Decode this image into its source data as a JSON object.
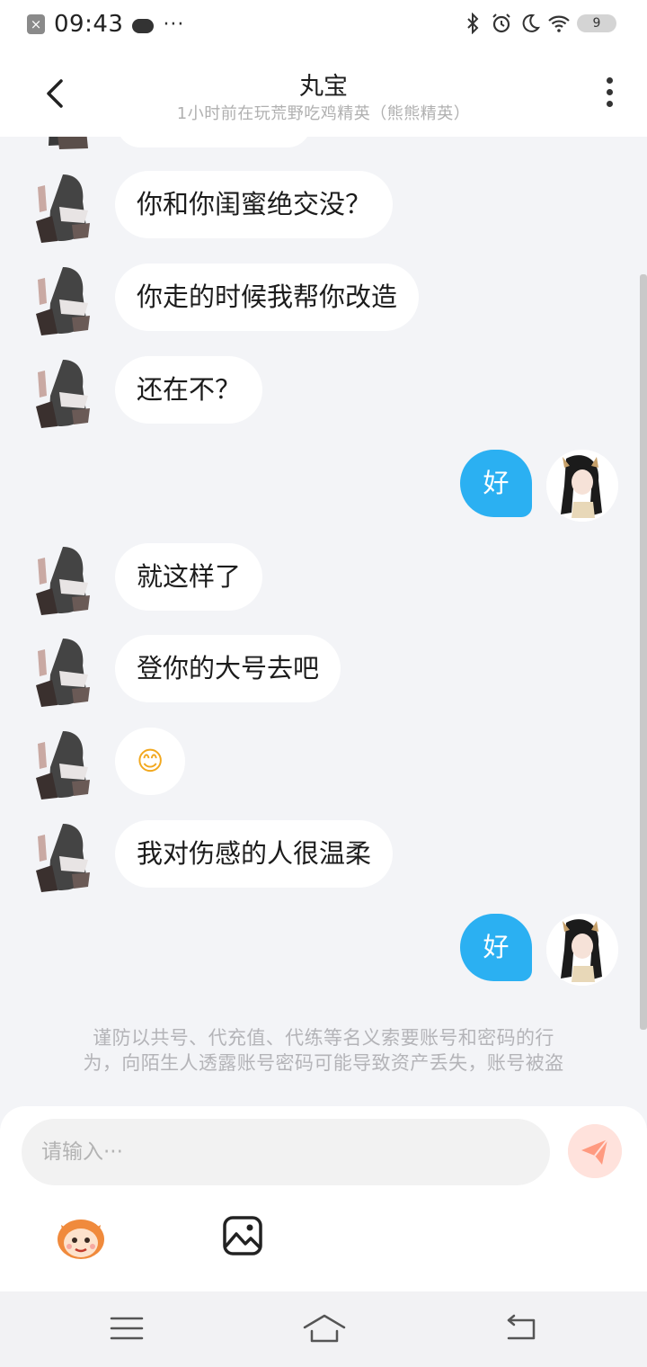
{
  "status_bar": {
    "time": "09:43",
    "notification_badge": "9",
    "more": "···",
    "icons": [
      "bluetooth-icon",
      "alarm-icon",
      "do-not-disturb-icon",
      "wifi-icon",
      "battery-icon"
    ]
  },
  "header": {
    "title": "丸宝",
    "subtitle": "1小时前在玩荒野吃鸡精英（熊熊精英）"
  },
  "messages": [
    {
      "from": "other",
      "text": "你和你闺蜜绝交没？"
    },
    {
      "from": "other",
      "text": "你走的时候我帮你改造"
    },
    {
      "from": "other",
      "text": "还在不？"
    },
    {
      "from": "me",
      "text": "好"
    },
    {
      "from": "other",
      "text": "就这样了"
    },
    {
      "from": "other",
      "text": "登你的大号去吧"
    },
    {
      "from": "other",
      "text": "😊"
    },
    {
      "from": "other",
      "text": "我对伤感的人很温柔"
    },
    {
      "from": "me",
      "text": "好"
    }
  ],
  "notice": {
    "line1": "谨防以共号、代充值、代练等名义索要账号和密码的行",
    "line2": "为，向陌生人透露账号密码可能导致资产丢失，账号被盗"
  },
  "composer": {
    "placeholder": "请输入···"
  },
  "colors": {
    "accent": "#2bb0f2",
    "background": "#f3f4f7",
    "send_button": "#ffe2dc",
    "send_icon": "#ff8c6e"
  }
}
